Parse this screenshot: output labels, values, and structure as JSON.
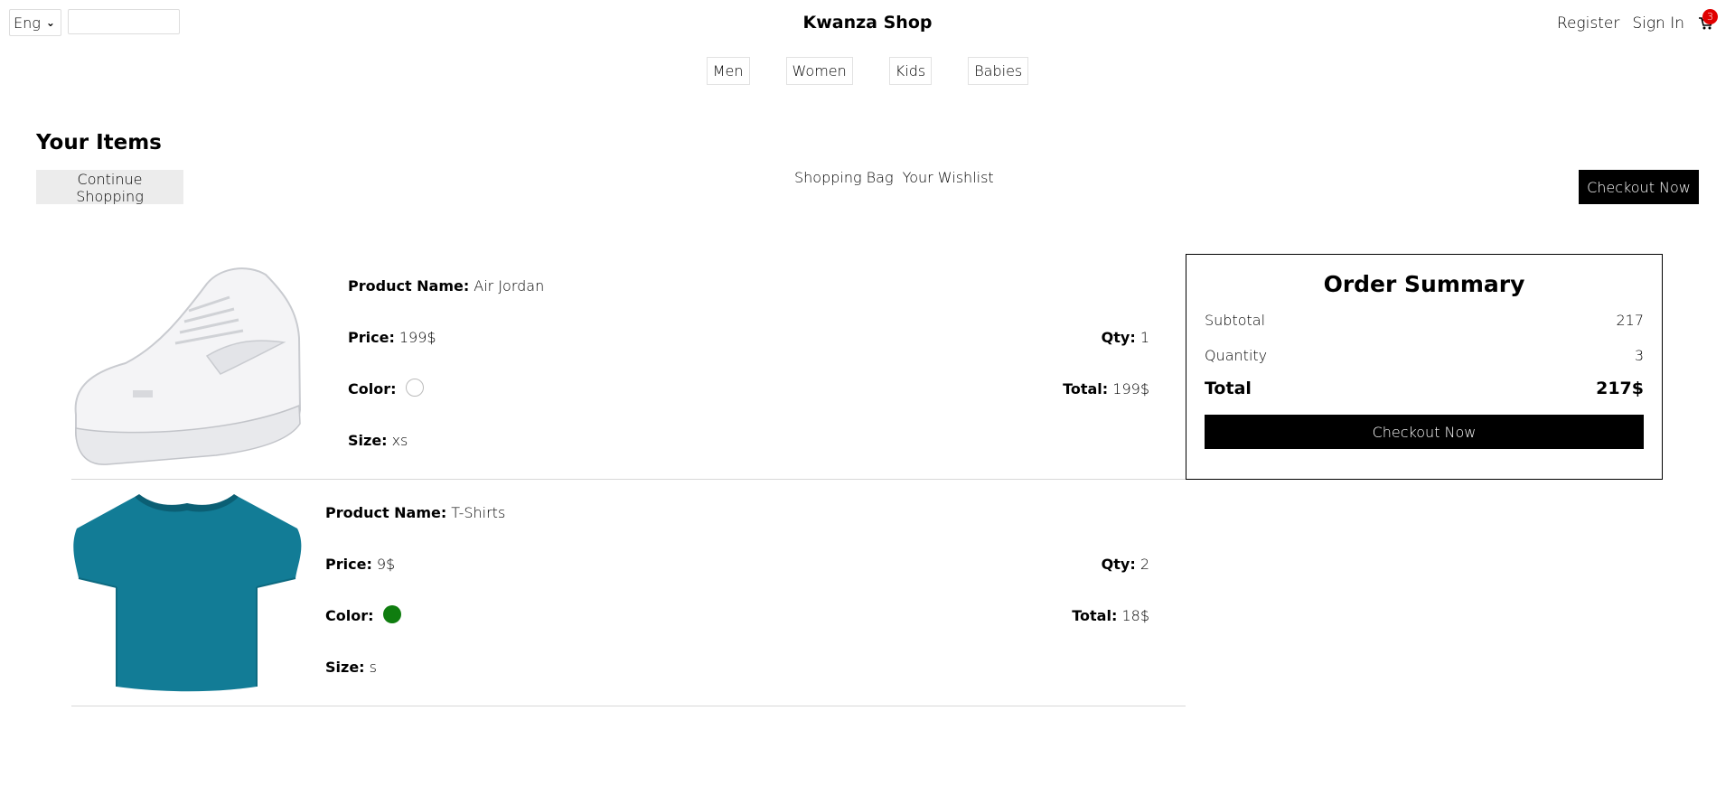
{
  "header": {
    "language": "Eng",
    "search_placeholder": "",
    "brand": "Kwanza Shop",
    "register": "Register",
    "sign_in": "Sign In",
    "cart_count": "3"
  },
  "nav": [
    "Men",
    "Women",
    "Kids",
    "Babies"
  ],
  "page": {
    "title": "Your Items",
    "continue_label": "Continue Shopping",
    "bag_label": "Shopping Bag",
    "wishlist_label": "Your Wishlist",
    "checkout_label": "Checkout Now"
  },
  "labels": {
    "product_name": "Product Name:",
    "price": "Price:",
    "color": "Color:",
    "size": "Size:",
    "qty": "Qty:",
    "total": "Total:"
  },
  "products": [
    {
      "name": "Air Jordan",
      "price": "199$",
      "color": "#ffffff",
      "size": "xs",
      "qty": "1",
      "total": "199$",
      "image_icon": "white-sneaker-image"
    },
    {
      "name": "T-Shirts",
      "price": "9$",
      "color": "#0f7d0f",
      "size": "s",
      "qty": "2",
      "total": "18$",
      "image_icon": "teal-tshirt-image"
    }
  ],
  "summary": {
    "title": "Order Summary",
    "subtotal_label": "Subtotal",
    "subtotal_value": "217",
    "quantity_label": "Quantity",
    "quantity_value": "3",
    "total_label": "Total",
    "total_value": "217$",
    "checkout_label": "Checkout Now"
  }
}
